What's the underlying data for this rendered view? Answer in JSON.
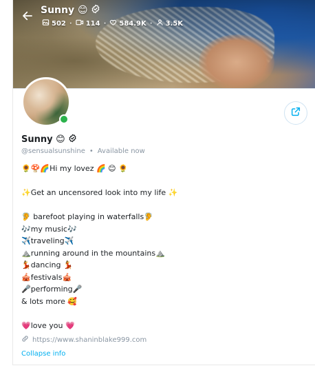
{
  "header": {
    "name": "Sunny 😊",
    "stats": {
      "photos": "502",
      "videos": "114",
      "likes": "584.9K",
      "fans": "3.5K"
    }
  },
  "profile": {
    "name": "Sunny 😊",
    "username": "@sensualsunshine",
    "status": "Available now",
    "separator": "•"
  },
  "bio": [
    "🌻🍄🌈Hi my lovez 🌈 😊 🌻",
    "",
    "✨Get an uncensored look into my life ✨",
    "",
    "🦻 barefoot playing in waterfalls🦻",
    "🎶my music🎶",
    "✈️traveling✈️",
    "⛰️running around in the mountains⛰️",
    "💃dancing 💃",
    "🎪festivals🎪",
    "🎤performing🎤",
    "& lots more 🥰",
    "",
    "💗love you 💗"
  ],
  "website": "https://www.shaninblake999.com",
  "collapse_label": "Collapse info",
  "colors": {
    "accent": "#00aff0",
    "online": "#2bb24c",
    "muted": "#8a96a3"
  }
}
